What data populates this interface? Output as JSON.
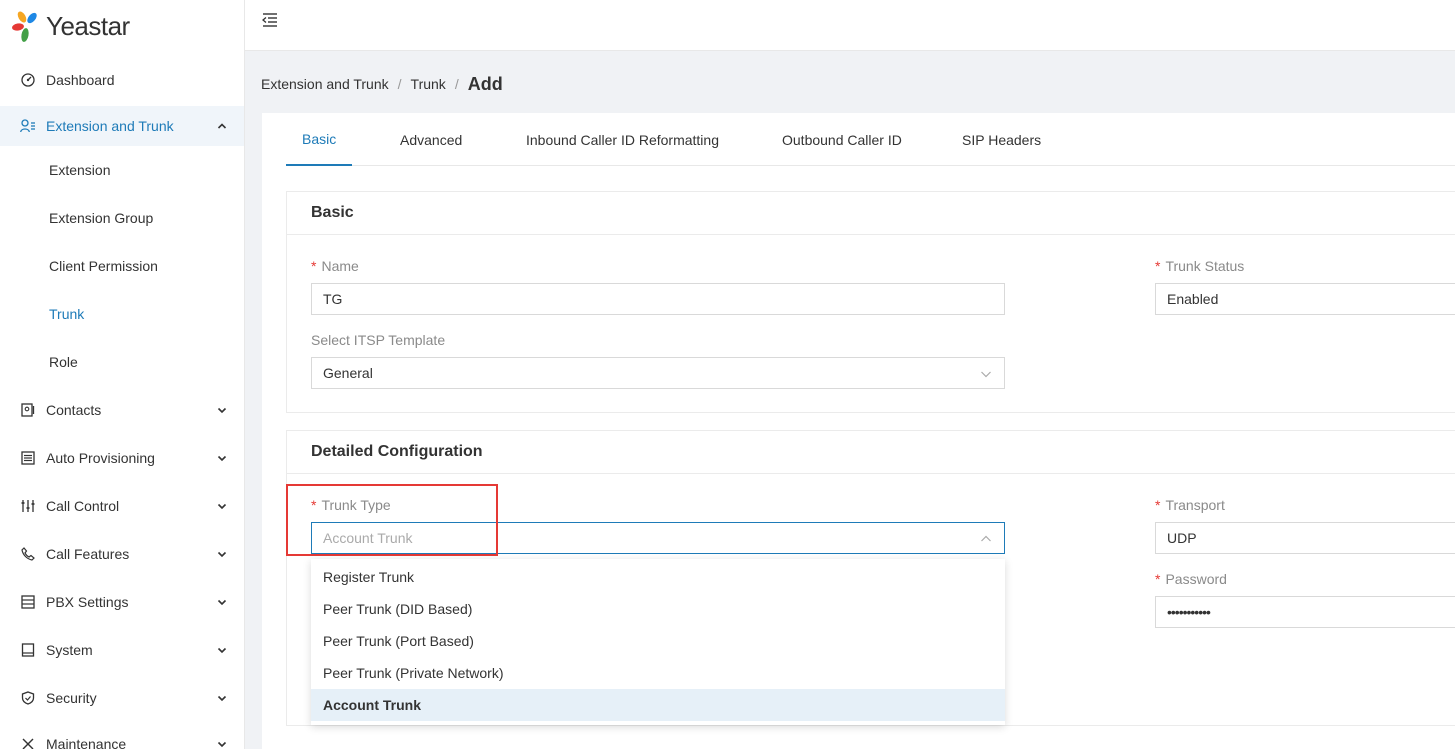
{
  "brand": {
    "name": "Yeastar"
  },
  "sidebar": {
    "items": [
      {
        "label": "Dashboard",
        "icon": "dashboard-icon"
      },
      {
        "label": "Extension and Trunk",
        "icon": "users-icon"
      },
      {
        "label": "Contacts",
        "icon": "contacts-icon"
      },
      {
        "label": "Auto Provisioning",
        "icon": "provisioning-icon"
      },
      {
        "label": "Call Control",
        "icon": "sliders-icon"
      },
      {
        "label": "Call Features",
        "icon": "phone-icon"
      },
      {
        "label": "PBX Settings",
        "icon": "settings-list-icon"
      },
      {
        "label": "System",
        "icon": "monitor-icon"
      },
      {
        "label": "Security",
        "icon": "shield-icon"
      },
      {
        "label": "Maintenance",
        "icon": "tools-icon"
      }
    ],
    "subitems": [
      "Extension",
      "Extension Group",
      "Client Permission",
      "Trunk",
      "Role"
    ]
  },
  "breadcrumb": {
    "level1": "Extension and Trunk",
    "level2": "Trunk",
    "current": "Add",
    "separator": "/"
  },
  "tabs": [
    "Basic",
    "Advanced",
    "Inbound Caller ID Reformatting",
    "Outbound Caller ID",
    "SIP Headers"
  ],
  "basic": {
    "title": "Basic",
    "name_label": "Name",
    "name_value": "TG",
    "trunk_status_label": "Trunk Status",
    "trunk_status_value": "Enabled",
    "itsp_label": "Select ITSP Template",
    "itsp_value": "General"
  },
  "detailed": {
    "title": "Detailed Configuration",
    "trunk_type_label": "Trunk Type",
    "trunk_type_placeholder": "Account Trunk",
    "transport_label": "Transport",
    "transport_value": "UDP",
    "password_label": "Password",
    "password_value": "•••••••••••"
  },
  "dropdown": {
    "options": [
      "Register Trunk",
      "Peer Trunk (DID Based)",
      "Peer Trunk (Port Based)",
      "Peer Trunk (Private Network)",
      "Account Trunk"
    ],
    "selected": "Account Trunk"
  },
  "required_mark": "*",
  "colors": {
    "accent": "#1e7bb8",
    "required": "#e53935",
    "highlight": "#e53935"
  }
}
